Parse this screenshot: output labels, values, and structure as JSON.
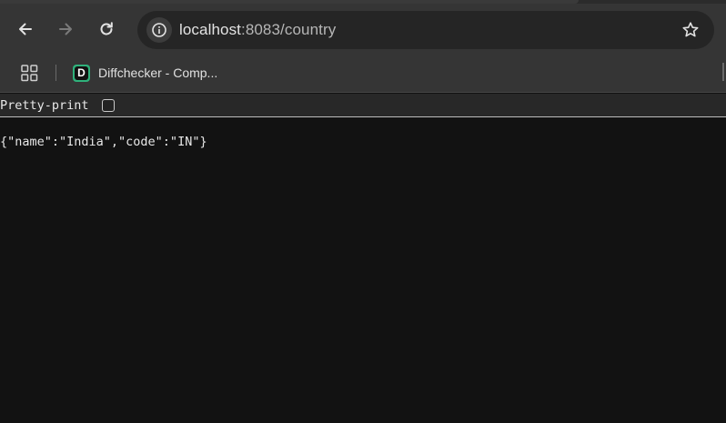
{
  "browser": {
    "url_host": "localhost",
    "url_rest": ":8083/country",
    "bookmark_label": "Diffchecker - Comp...",
    "bookmark_favicon_letter": "D",
    "accent_favicon": "#2fb17b"
  },
  "viewer": {
    "pretty_print_label": "Pretty-print",
    "pretty_print_checked": false
  },
  "body_text": "{\"name\":\"India\",\"code\":\"IN\"}"
}
